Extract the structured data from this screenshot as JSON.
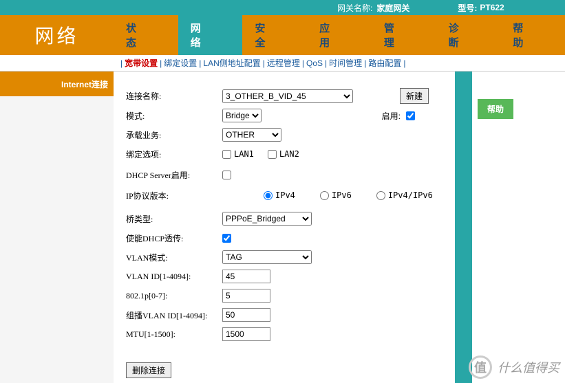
{
  "topbar": {
    "gateway_label": "网关名称:",
    "gateway_name": "家庭网关",
    "model_label": "型号:",
    "model_value": "PT622"
  },
  "logo": "网络",
  "nav": {
    "items": [
      "状 态",
      "网 络",
      "安 全",
      "应 用",
      "管 理",
      "诊 断",
      "帮 助"
    ],
    "active_index": 1
  },
  "subnav": {
    "items": [
      "宽带设置",
      "绑定设置",
      "LAN侧地址配置",
      "远程管理",
      "QoS",
      "时间管理",
      "路由配置"
    ],
    "active_index": 0
  },
  "left": {
    "header": "Internet连接"
  },
  "right": {
    "help": "帮助"
  },
  "form": {
    "conn_name_label": "连接名称:",
    "conn_name_value": "3_OTHER_B_VID_45",
    "new_btn": "新建",
    "mode_label": "模式:",
    "mode_value": "Bridge",
    "enable_label": "启用:",
    "enable_checked": true,
    "service_label": "承载业务:",
    "service_value": "OTHER",
    "bind_label": "绑定选项:",
    "bind_lan1": "LAN1",
    "bind_lan2": "LAN2",
    "dhcp_server_label": "DHCP Server启用:",
    "ip_version_label": "IP协议版本:",
    "ip_v4": "IPv4",
    "ip_v6": "IPv6",
    "ip_both": "IPv4/IPv6",
    "bridge_type_label": "桥类型:",
    "bridge_type_value": "PPPoE_Bridged",
    "dhcp_passthrough_label": "使能DHCP透传:",
    "vlan_mode_label": "VLAN模式:",
    "vlan_mode_value": "TAG",
    "vlan_id_label": "VLAN ID[1-4094]:",
    "vlan_id_value": "45",
    "dot1p_label": "802.1p[0-7]:",
    "dot1p_value": "5",
    "multicast_vlan_label": "组播VLAN ID[1-4094]:",
    "multicast_vlan_value": "50",
    "mtu_label": "MTU[1-1500]:",
    "mtu_value": "1500",
    "delete_btn": "删除连接"
  },
  "watermark": {
    "char": "值",
    "text": "什么值得买"
  }
}
